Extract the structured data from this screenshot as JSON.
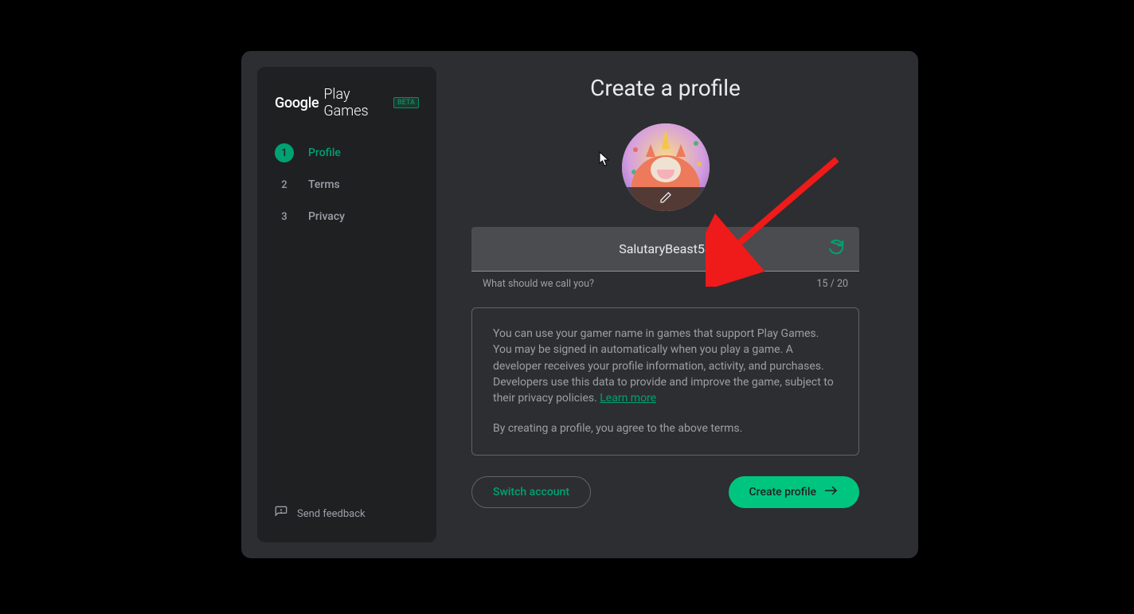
{
  "brand": {
    "google": "Google",
    "play": "Play Games",
    "badge": "BETA"
  },
  "sidebar": {
    "steps": [
      {
        "num": "1",
        "label": "Profile",
        "active": true
      },
      {
        "num": "2",
        "label": "Terms",
        "active": false
      },
      {
        "num": "3",
        "label": "Privacy",
        "active": false
      }
    ],
    "feedback": "Send feedback"
  },
  "main": {
    "title": "Create a profile",
    "username_input": {
      "value": "SalutaryBeast58",
      "helper": "What should we call you?",
      "counter": "15 / 20"
    },
    "info": {
      "p1_a": "You can use your gamer name in games that support Play Games. You may be signed in automatically when you play a game. A developer receives your profile information, activity, and purchases. Developers use this data to provide and improve the game, subject to their privacy policies. ",
      "learn_more": "Learn more",
      "p2": "By creating a profile, you agree to the above terms."
    },
    "buttons": {
      "switch": "Switch account",
      "create": "Create profile"
    }
  }
}
